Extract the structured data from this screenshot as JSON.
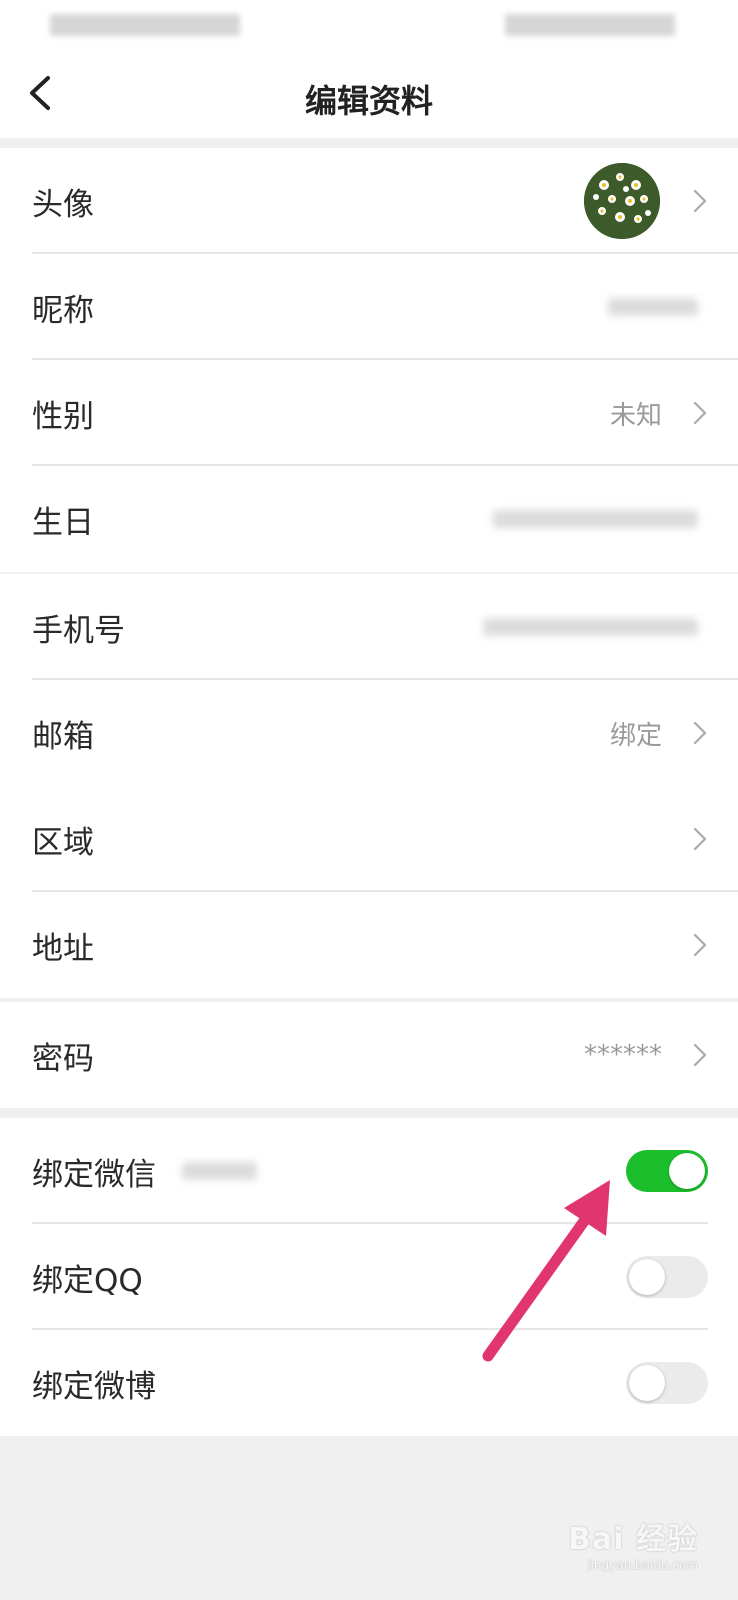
{
  "header": {
    "title": "编辑资料",
    "back_icon": "chevron-left-icon"
  },
  "profile_section": {
    "avatar": {
      "label": "头像"
    },
    "nickname": {
      "label": "昵称"
    },
    "gender": {
      "label": "性别",
      "value": "未知"
    },
    "birthday": {
      "label": "生日"
    }
  },
  "contact_section": {
    "phone": {
      "label": "手机号"
    },
    "email": {
      "label": "邮箱",
      "value": "绑定"
    },
    "region": {
      "label": "区域"
    },
    "address": {
      "label": "地址"
    }
  },
  "security_section": {
    "password": {
      "label": "密码",
      "value": "******"
    }
  },
  "binding_section": {
    "wechat": {
      "label": "绑定微信",
      "enabled": true
    },
    "qq": {
      "label": "绑定QQ",
      "enabled": false
    },
    "weibo": {
      "label": "绑定微博",
      "enabled": false
    }
  },
  "colors": {
    "toggle_on": "#1bbf2b",
    "toggle_off": "#ebebeb",
    "annotation_arrow": "#e0356e"
  },
  "watermark": {
    "brand": "Bai 经验",
    "url": "jingyan.baidu.com"
  }
}
